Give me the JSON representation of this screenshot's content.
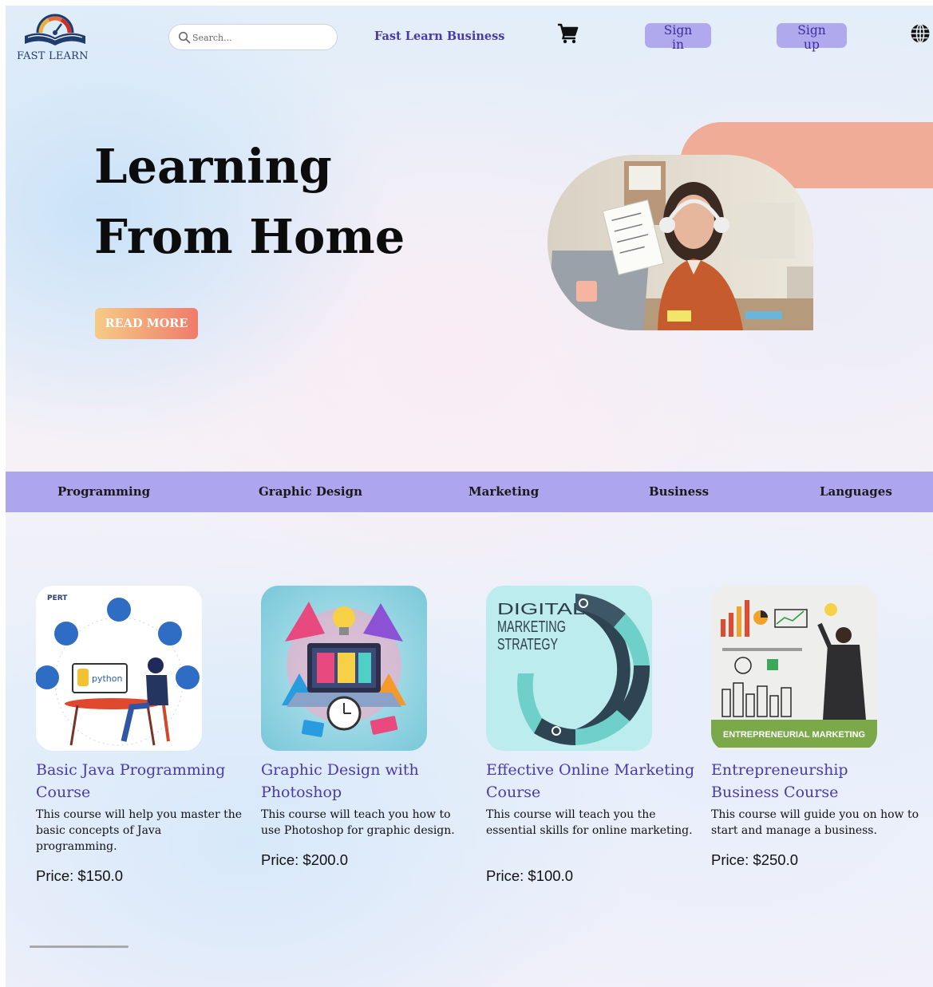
{
  "brand": {
    "name": "FAST LEARN",
    "logo_icon": "book-speedometer-logo"
  },
  "header": {
    "search_placeholder": "Search...",
    "business_link": "Fast Learn Business",
    "sign_in": "Sign in",
    "sign_up": "Sign up"
  },
  "hero": {
    "title_line1": "Learning",
    "title_line2": "From Home",
    "cta": "READ MORE"
  },
  "categories": [
    {
      "label": "Programming"
    },
    {
      "label": "Graphic Design"
    },
    {
      "label": "Marketing"
    },
    {
      "label": "Business"
    },
    {
      "label": "Languages"
    }
  ],
  "courses": [
    {
      "title": "Basic Java Programming Course",
      "description": "This course will help you master the basic concepts of Java programming.",
      "price": "Price: $150.0",
      "image_text": "python",
      "badge_text": "PERT"
    },
    {
      "title": "Graphic Design with Photoshop",
      "description": "This course will teach you how to use Photoshop for graphic design.",
      "price": "Price: $200.0"
    },
    {
      "title": "Effective Online Marketing Course",
      "description": "This course will teach you the essential skills for online marketing.",
      "price": "Price: $100.0",
      "image_text": "DIGITAL MARKETING STRATEGY"
    },
    {
      "title": "Entrepreneurship Business Course",
      "description": "This course will guide you on how to start and manage a business.",
      "price": "Price: $250.0",
      "image_text": "ENTREPRENEURIAL MARKETING"
    }
  ],
  "colors": {
    "accent": "#ada6ee",
    "button_bg": "#b0a9ee",
    "button_text": "#3b2d9e",
    "title_purple": "#4a3ab0",
    "cta_gradient_start": "#f6cb86",
    "cta_gradient_end": "#ef7b6a",
    "hero_band": "#f0ac96"
  }
}
